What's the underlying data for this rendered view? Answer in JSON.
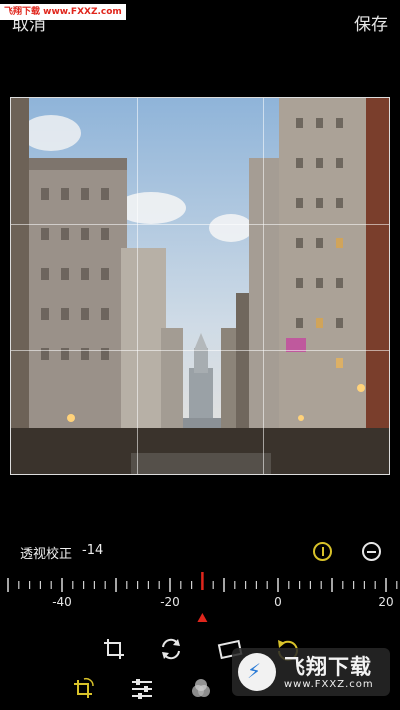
{
  "header": {
    "cancel_label": "取消",
    "save_label": "保存",
    "top_watermark": "飞翔下载 www.FXXZ.com"
  },
  "adjustment": {
    "label": "透视校正",
    "value": "-14"
  },
  "ruler": {
    "tick_labels": [
      "-40",
      "-20",
      "0",
      "20"
    ],
    "current_value": -14,
    "accent_color": "#e0261c"
  },
  "toolbar": {
    "row1": [
      "crop-icon",
      "rotate-icon",
      "flip-icon",
      "undo-icon"
    ],
    "row2": [
      "crop-rotate-icon",
      "adjust-sliders-icon",
      "filter-icon"
    ],
    "active_color": "#d8c22a"
  },
  "watermark": {
    "cn_text": "飞翔下载",
    "url": "www.FXXZ.com"
  }
}
